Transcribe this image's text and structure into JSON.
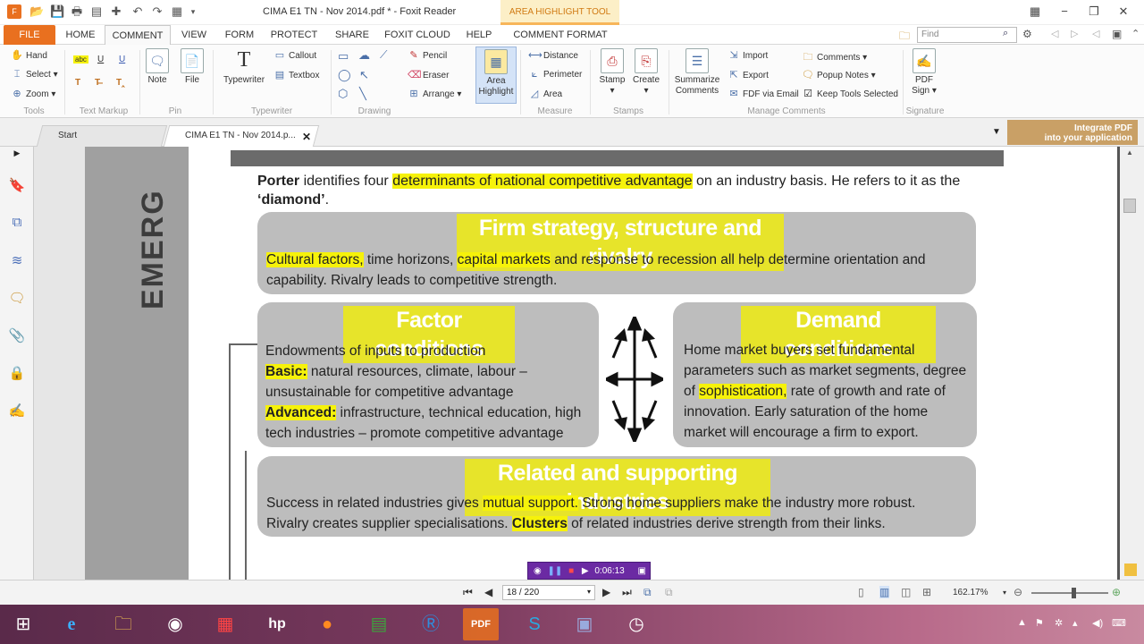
{
  "window": {
    "title": "CIMA E1 TN - Nov 2014.pdf * - Foxit Reader",
    "context_tool_tab": "AREA HIGHLIGHT TOOL"
  },
  "menu": {
    "file": "FILE",
    "tabs": [
      "HOME",
      "COMMENT",
      "VIEW",
      "FORM",
      "PROTECT",
      "SHARE",
      "FOXIT CLOUD",
      "HELP",
      "COMMENT FORMAT"
    ],
    "find_placeholder": "Find"
  },
  "ribbon": {
    "tools": {
      "hand": "Hand",
      "select": "Select",
      "zoom": "Zoom",
      "group": "Tools"
    },
    "text_markup": {
      "group": "Text Markup"
    },
    "pin": {
      "note": "Note",
      "file": "File",
      "group": "Pin"
    },
    "typewriter": {
      "typewriter": "Typewriter",
      "callout": "Callout",
      "textbox": "Textbox",
      "group": "Typewriter"
    },
    "drawing": {
      "pencil": "Pencil",
      "eraser": "Eraser",
      "arrange": "Arrange",
      "group": "Drawing"
    },
    "area_highlight": {
      "label1": "Area",
      "label2": "Highlight"
    },
    "measure": {
      "distance": "Distance",
      "perimeter": "Perimeter",
      "area": "Area",
      "group": "Measure"
    },
    "stamps": {
      "stamp": "Stamp",
      "create": "Create",
      "group": "Stamps"
    },
    "manage": {
      "summarize1": "Summarize",
      "summarize2": "Comments",
      "import": "Import",
      "export": "Export",
      "fdf": "FDF via Email",
      "comments": "Comments",
      "popup": "Popup Notes",
      "keep": "Keep Tools Selected",
      "group": "Manage Comments"
    },
    "signature": {
      "pdf": "PDF",
      "sign": "Sign",
      "group": "Signature"
    }
  },
  "doc_tabs": {
    "start": "Start",
    "current": "CIMA E1 TN - Nov 2014.p...",
    "banner_line1": "Integrate PDF",
    "banner_line2": "into your application"
  },
  "document": {
    "vertical_heading": "EMERG",
    "intro": {
      "p1": "Porter",
      "p2": " identifies four ",
      "p3": "determinants of national competitive advantage",
      "p4": " on an industry basis. He refers to it as the",
      "p5": "‘diamond’",
      "p6": "."
    },
    "firm": {
      "heading": "Firm strategy, structure and rivalry",
      "t1": "Cultural factors,",
      "t2": " time horizons, ",
      "t3": "capital markets",
      "t4": " and response to recession all help determine orientation and",
      "t5": "capability. Rivalry leads to competitive strength."
    },
    "factor": {
      "heading": "Factor conditions",
      "l1": "Endowments of inputs to production",
      "basic": "Basic:",
      "l2": " natural resources, climate, labour –",
      "l3": "unsustainable for competitive advantage",
      "advanced": "Advanced:",
      "l4": " infrastructure, technical education, high",
      "l5": "tech industries – promote competitive advantage"
    },
    "demand": {
      "heading": "Demand conditions",
      "l1": "Home market buyers set fundamental",
      "l2": "parameters such as market segments, degree",
      "l3a": "of ",
      "l3b": "sophistication,",
      "l3c": " rate of growth and rate of",
      "l4": "innovation. Early saturation of the home",
      "l5": "market will encourage a firm to export."
    },
    "related": {
      "heading": "Related and supporting industries",
      "l1a": "Success in related industries gives ",
      "l1b": "mutual support.",
      "l1c": " Strong home suppliers make the industry more robust.",
      "l2a": "Rivalry creates supplier specialisations. ",
      "l2b": "Clusters",
      "l2c": " of related industries derive strength from their links."
    }
  },
  "recorder": {
    "time": "0:06:13"
  },
  "status": {
    "page": "18 / 220",
    "zoom": "162.17%"
  },
  "colors": {
    "accent": "#e9701f",
    "highlight": "#f6f20a",
    "box": "#bdbdbd",
    "box_heading": "#e7e42a"
  }
}
